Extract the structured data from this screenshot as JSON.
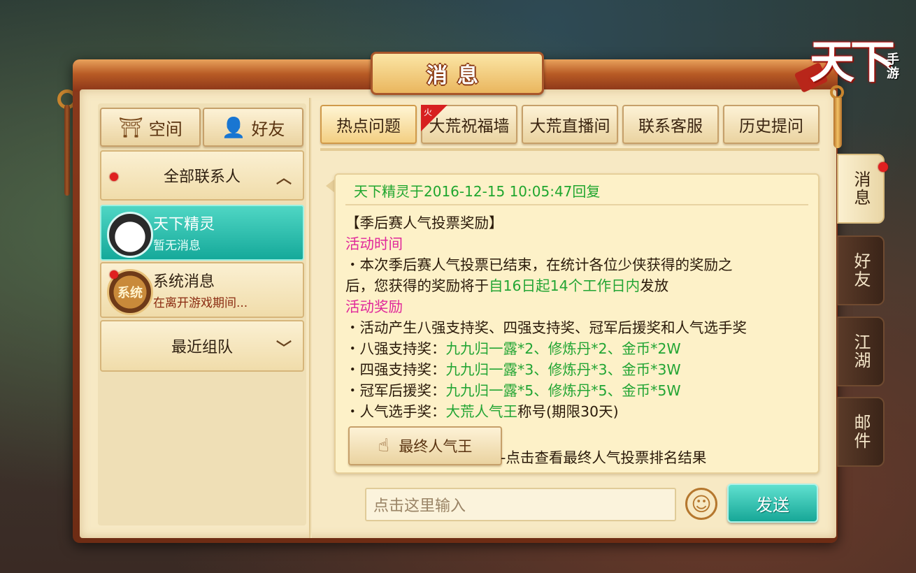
{
  "logo": {
    "main": "天下",
    "sub": "手游"
  },
  "window": {
    "title": "消息"
  },
  "left": {
    "space_label": "空间",
    "friends_label": "好友",
    "all_contacts_label": "全部联系人",
    "contacts": [
      {
        "name": "天下精灵",
        "preview": "暂无消息",
        "avatar_text": ""
      },
      {
        "name": "系统消息",
        "preview": "在离开游戏期间...",
        "avatar_text": "系统"
      }
    ],
    "recent_team_label": "最近组队"
  },
  "tabs": [
    {
      "label": "热点问题",
      "selected": true
    },
    {
      "label": "大荒祝福墙",
      "badge": "火"
    },
    {
      "label": "大荒直播间"
    },
    {
      "label": "联系客服"
    },
    {
      "label": "历史提问"
    }
  ],
  "message": {
    "header": "天下精灵于2016-12-15 10:05:47回复",
    "title": "【季后赛人气投票奖励】",
    "section1_title": "活动时间",
    "s1_line1": "・本次季后赛人气投票已结束，在统计各位少侠获得的奖励之",
    "s1_line2a": "后，您获得的奖励将于",
    "s1_line2b": "自16日起14个工作日内",
    "s1_line2c": "发放",
    "section2_title": "活动奖励",
    "s2_line1": "・活动产生八强支持奖、四强支持奖、冠军后援奖和人气选手奖",
    "reward_rows": [
      {
        "label": "・八强支持奖：",
        "value": "九九归一露*2、修炼丹*2、金币*2W",
        "suffix": ""
      },
      {
        "label": "・四强支持奖：",
        "value": "九九归一露*3、修炼丹*3、金币*3W",
        "suffix": ""
      },
      {
        "label": "・冠军后援奖：",
        "value": "九九归一露*5、修炼丹*5、金币*5W",
        "suffix": ""
      },
      {
        "label": "・人气选手奖：",
        "value": "大荒人气王",
        "suffix": "称号(期限30天)"
      }
    ],
    "rank_button": "最终人气王",
    "rank_note": "-点击查看最终人气投票排名结果"
  },
  "input": {
    "placeholder": "点击这里输入",
    "value": ""
  },
  "send_label": "发送",
  "side_tabs": [
    {
      "label": "消息",
      "active": true,
      "badge": true
    },
    {
      "label": "好友"
    },
    {
      "label": "江湖"
    },
    {
      "label": "邮件"
    }
  ],
  "colors": {
    "accent_teal": "#1fb3a3",
    "green_text": "#23a534",
    "pink_text": "#e0279a",
    "red_badge": "#e02020"
  }
}
